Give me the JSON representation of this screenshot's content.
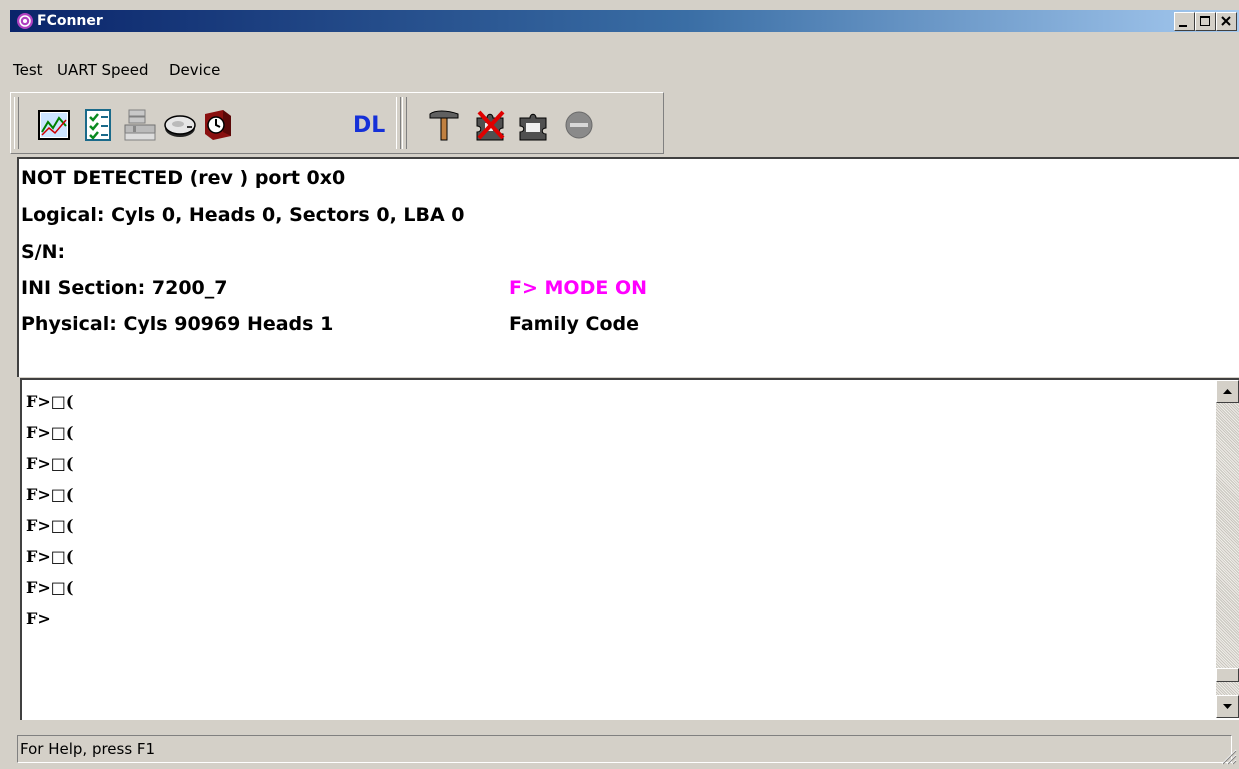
{
  "window": {
    "title": "FConner",
    "buttons": [
      "minimize",
      "maximize",
      "close"
    ]
  },
  "menu": [
    {
      "label": "Test"
    },
    {
      "label": "UART Speed"
    },
    {
      "label": "Device"
    }
  ],
  "toolbar": {
    "group1": [
      {
        "icon": "chart-icon"
      },
      {
        "icon": "checklist-icon"
      },
      {
        "icon": "drive-stack-icon"
      },
      {
        "icon": "disk-icon"
      },
      {
        "icon": "timer-icon"
      },
      {
        "icon": "dl-icon",
        "text": "DL"
      }
    ],
    "group2": [
      {
        "icon": "hammer-icon"
      },
      {
        "icon": "puzzle-disabled-icon"
      },
      {
        "icon": "puzzle-icon"
      },
      {
        "icon": "stop-icon"
      }
    ]
  },
  "info": {
    "line1": "NOT DETECTED (rev ) port 0x0",
    "line2": "Logical: Cyls 0, Heads 0, Sectors 0, LBA 0",
    "line3": "S/N:",
    "line4": "INI Section: 7200_7",
    "line4_right": "F> MODE ON",
    "line5": "Physical: Cyls 90969 Heads 1",
    "line5_right": "Family Code",
    "mode_color": "#ff00ff"
  },
  "console": {
    "lines": [
      "F>□(",
      "F>□(",
      "F>□(",
      "F>□(",
      "F>□(",
      "F>□(",
      "F>□(",
      "F>"
    ]
  },
  "status": {
    "text": "For Help, press F1"
  }
}
